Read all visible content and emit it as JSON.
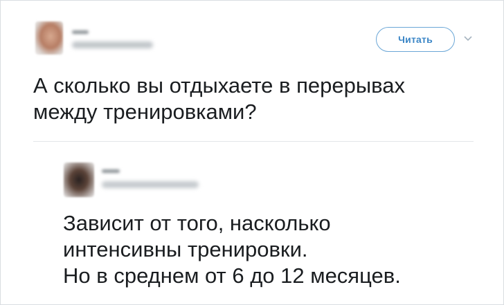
{
  "top_tweet": {
    "follow_label": "Читать",
    "text_lines": [
      "А сколько вы отдыхаете в перерывах",
      "между тренировками?"
    ]
  },
  "reply_tweet": {
    "text_lines": [
      "Зависит от того, насколько",
      "интенсивны тренировки.",
      "Но в среднем от 6 до 12 месяцев."
    ]
  },
  "icons": {
    "menu": "chevron-down-icon"
  },
  "colors": {
    "accent": "#3b86c6",
    "button_border": "#6aa6d6",
    "text": "#1a1d20",
    "divider": "#e3e6e9"
  }
}
